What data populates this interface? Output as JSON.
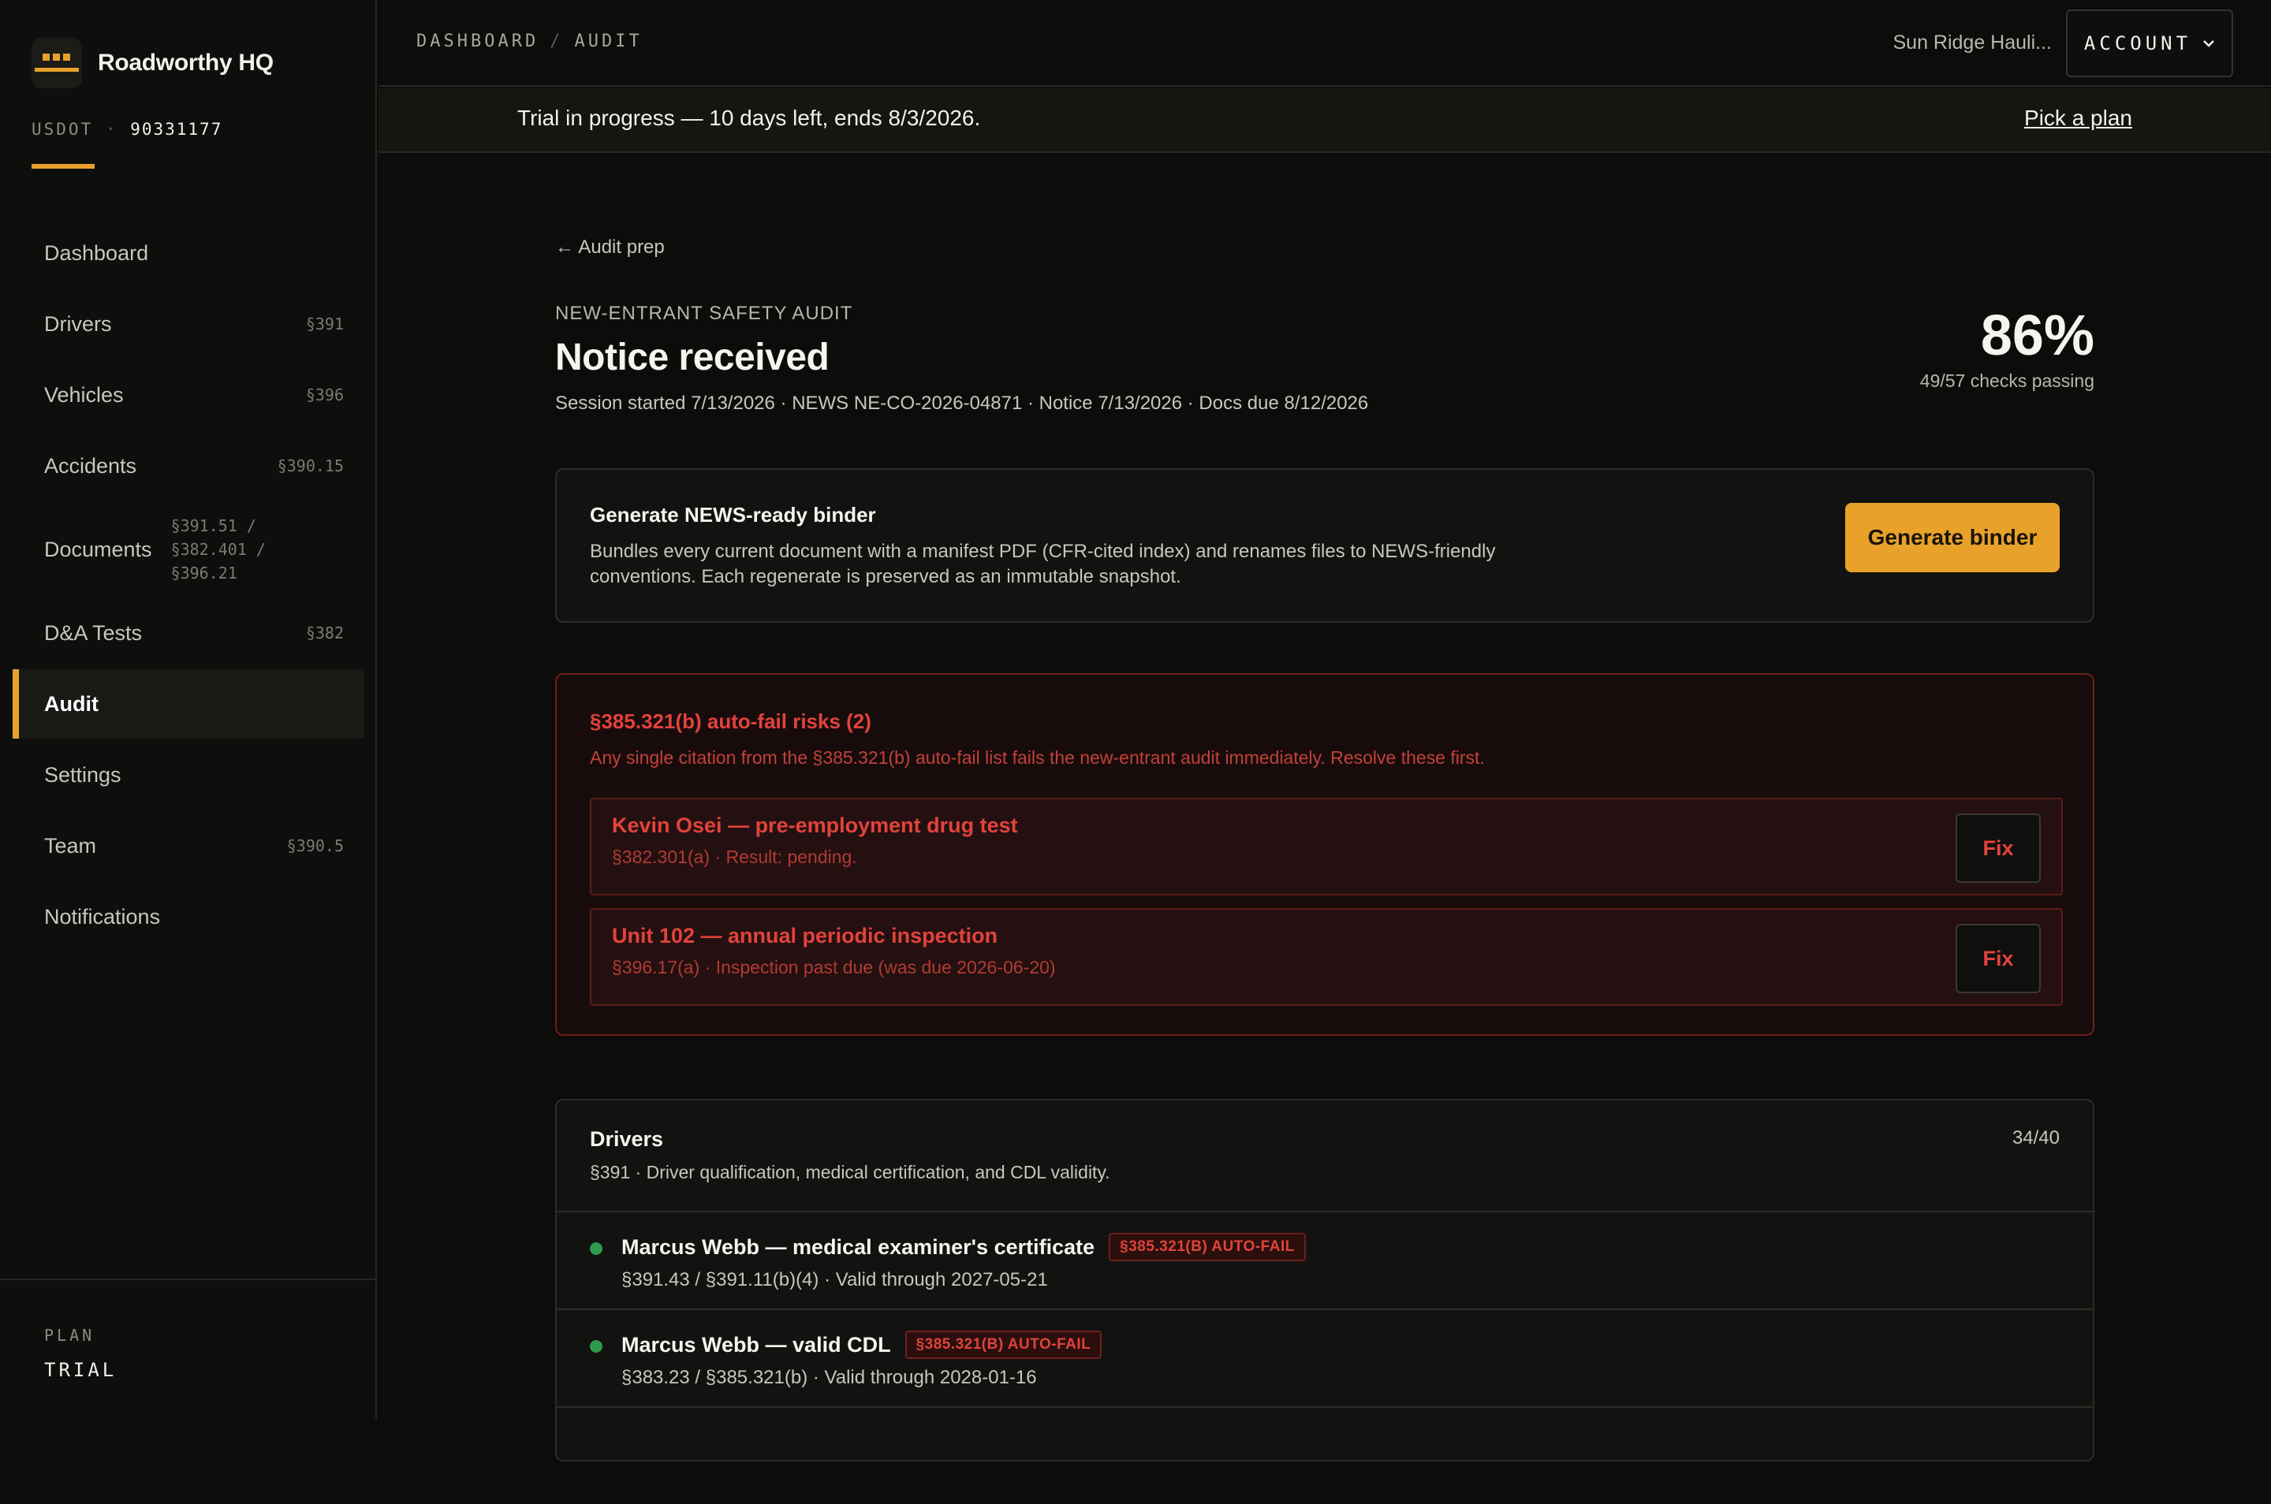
{
  "app": {
    "name": "Roadworthy HQ"
  },
  "usdot": {
    "label": "USDOT",
    "separator": "·",
    "number": "90331177"
  },
  "nav": {
    "items": [
      {
        "label": "Dashboard",
        "cite": ""
      },
      {
        "label": "Drivers",
        "cite": "§391"
      },
      {
        "label": "Vehicles",
        "cite": "§396"
      },
      {
        "label": "Accidents",
        "cite": "§390.15"
      },
      {
        "label": "Documents",
        "cite_lines": [
          "§391.51 /",
          "§382.401 /",
          "§396.21"
        ]
      },
      {
        "label": "D&A Tests",
        "cite": "§382"
      },
      {
        "label": "Audit",
        "cite": "",
        "active": true
      },
      {
        "label": "Settings",
        "cite": ""
      },
      {
        "label": "Team",
        "cite": "§390.5"
      },
      {
        "label": "Notifications",
        "cite": ""
      }
    ]
  },
  "plan": {
    "label": "PLAN",
    "value": "TRIAL"
  },
  "topbar": {
    "breadcrumb": [
      "DASHBOARD",
      "AUDIT"
    ],
    "breadcrumb_sep": "/",
    "org_name": "Sun Ridge Hauli...",
    "account_label": "ACCOUNT"
  },
  "trial": {
    "message": "Trial in progress — 10 days left, ends 8/3/2026.",
    "link": "Pick a plan"
  },
  "audit": {
    "back": "← Audit prep",
    "eyebrow": "NEW-ENTRANT SAFETY AUDIT",
    "title": "Notice received",
    "meta": "Session started 7/13/2026 · NEWS NE-CO-2026-04871 · Notice 7/13/2026 · Docs due 8/12/2026",
    "score": {
      "percent": "86%",
      "checks": "49/57 checks passing"
    }
  },
  "binder": {
    "title": "Generate NEWS-ready binder",
    "description": "Bundles every current document with a manifest PDF (CFR-cited index) and renames files to NEWS-friendly conventions. Each regenerate is preserved as an immutable snapshot.",
    "button": "Generate binder"
  },
  "autofail": {
    "title": "§385.321(b) auto-fail risks (2)",
    "description": "Any single citation from the §385.321(b) auto-fail list fails the new-entrant audit immediately. Resolve these first.",
    "items": [
      {
        "title": "Kevin Osei — pre-employment drug test",
        "sub": "§382.301(a) · Result: pending.",
        "action": "Fix"
      },
      {
        "title": "Unit 102 — annual periodic inspection",
        "sub": "§396.17(a) · Inspection past due (was due 2026-06-20)",
        "action": "Fix"
      }
    ]
  },
  "drivers_section": {
    "title": "Drivers",
    "description": "§391 · Driver qualification, medical certification, and CDL validity.",
    "count": "34/40",
    "rows": [
      {
        "title": "Marcus Webb — medical examiner's certificate",
        "badge": "§385.321(B) AUTO-FAIL",
        "sub": "§391.43 / §391.11(b)(4) · Valid through 2027-05-21",
        "status_color": "#2f9a4e"
      },
      {
        "title": "Marcus Webb — valid CDL",
        "badge": "§385.321(B) AUTO-FAIL",
        "sub": "§383.23 / §385.321(b) · Valid through 2028-01-16",
        "status_color": "#2f9a4e"
      }
    ]
  },
  "colors": {
    "accent": "#e8a22a",
    "danger": "#e2433b",
    "ok": "#2f9a4e"
  },
  "icons": {
    "brand": "truck-logo-icon",
    "account_chevron": "chevron-down-icon",
    "status": "status-dot-icon"
  }
}
